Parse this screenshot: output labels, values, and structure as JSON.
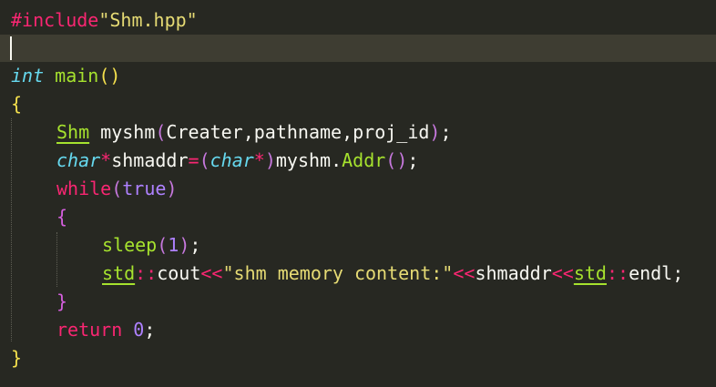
{
  "editor": {
    "colors": {
      "background": "#272822",
      "current_line": "#3e3d32",
      "keyword": "#f92672",
      "string": "#e6db74",
      "type": "#66d9ef",
      "function": "#a6e22e",
      "number": "#ae81ff"
    },
    "lines": {
      "l1": {
        "directive": "#include",
        "header": "\"Shm.hpp\""
      },
      "l3": {
        "type": "int",
        "name": "main",
        "lp": "(",
        "rp": ")"
      },
      "l4": {
        "brace": "{"
      },
      "l5": {
        "cls": "Shm",
        "var": " myshm",
        "lp": "(",
        "args": "Creater,pathname,proj_id",
        "rp": ")",
        "semi": ";"
      },
      "l6": {
        "type": "char",
        "star": "*",
        "var": "shmaddr",
        "eq": "=",
        "lp": "(",
        "cast": "char",
        "star2": "*",
        "rp": ")",
        "obj": "myshm.",
        "method": "Addr",
        "calllp": "(",
        "callrp": ")",
        "semi": ";"
      },
      "l7": {
        "kw": "while",
        "lp": "(",
        "cond": "true",
        "rp": ")"
      },
      "l8": {
        "brace": "{"
      },
      "l9": {
        "fn": "sleep",
        "lp": "(",
        "num": "1",
        "rp": ")",
        "semi": ";"
      },
      "l10": {
        "ns": "std",
        "scope1": "::",
        "cout": "cout",
        "op1": "<<",
        "str": "\"shm memory content:\"",
        "op2": "<<",
        "var": "shmaddr",
        "op3": "<<",
        "ns2": "std",
        "scope2": "::",
        "endl": "endl",
        "semi": ";"
      },
      "l11": {
        "brace": "}"
      },
      "l12": {
        "kw": "return",
        "num": "0",
        "semi": ";"
      },
      "l13": {
        "brace": "}"
      }
    }
  }
}
